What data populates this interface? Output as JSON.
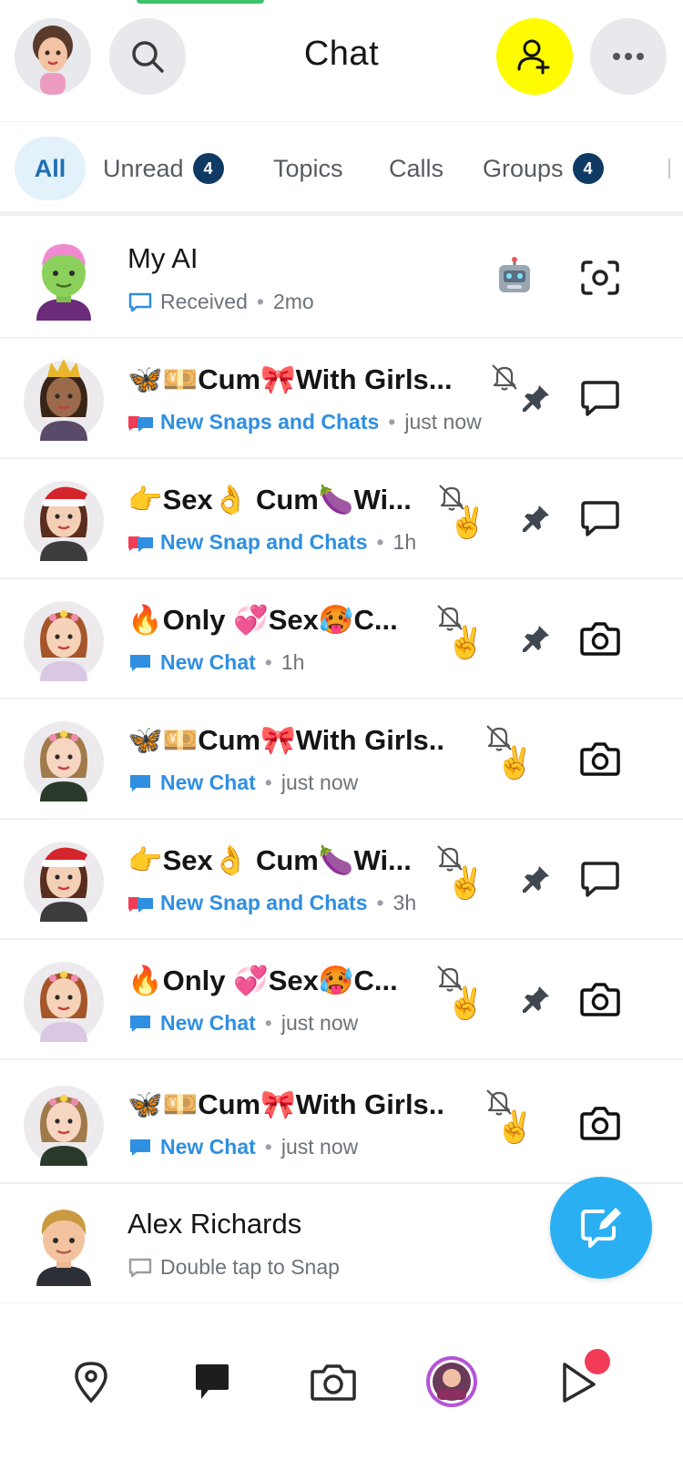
{
  "header": {
    "title": "Chat"
  },
  "tabs": [
    {
      "label": "All"
    },
    {
      "label": "Unread",
      "badge": "4"
    },
    {
      "label": "Topics"
    },
    {
      "label": "Calls"
    },
    {
      "label": "Groups",
      "badge": "4"
    }
  ],
  "chats": [
    {
      "name": "My AI",
      "status": "Received",
      "time": "2mo",
      "right_icon": "chat-icon",
      "extra_icon": "robot-icon"
    },
    {
      "name": "🦋💴Cum🎀With Girls...",
      "status": "New Snaps and Chats",
      "time": "just now",
      "muted": true,
      "pinned": true,
      "right_icon": "chat-icon"
    },
    {
      "name": "👉Sex👌 Cum🍆Wi...",
      "status": "New Snap and Chats",
      "time": "1h",
      "muted": true,
      "hand": "✌️",
      "pinned": true,
      "right_icon": "chat-icon"
    },
    {
      "name": "🔥Only 💞Sex🥵C...",
      "status": "New Chat",
      "time": "1h",
      "muted": true,
      "hand": "✌️",
      "pinned": true,
      "right_icon": "camera-icon"
    },
    {
      "name": "🦋💴Cum🎀With Girls..",
      "status": "New Chat",
      "time": "just now",
      "muted": true,
      "hand": "✌️",
      "right_icon": "camera-icon"
    },
    {
      "name": "👉Sex👌 Cum🍆Wi...",
      "status": "New Snap and Chats",
      "time": "3h",
      "muted": true,
      "hand": "✌️",
      "pinned": true,
      "right_icon": "chat-icon"
    },
    {
      "name": "🔥Only 💞Sex🥵C...",
      "status": "New Chat",
      "time": "just now",
      "muted": true,
      "hand": "✌️",
      "pinned": true,
      "right_icon": "camera-icon"
    },
    {
      "name": "🦋💴Cum🎀With Girls..",
      "status": "New Chat",
      "time": "just now",
      "muted": true,
      "hand": "✌️",
      "right_icon": "camera-icon"
    },
    {
      "name": "Alex Richards",
      "status": "Double tap to Snap"
    }
  ],
  "colors": {
    "accent_blue": "#2f8fe0",
    "snap_red": "#f23c57",
    "snap_yellow": "#fffc00",
    "fab_blue": "#2ab0f2",
    "badge_navy": "#0f3a63"
  },
  "bottom_nav": [
    {
      "icon": "map-pin-icon"
    },
    {
      "icon": "chat-bubble-icon",
      "active": true
    },
    {
      "icon": "camera-icon"
    },
    {
      "icon": "stories-icon"
    },
    {
      "icon": "spotlight-icon",
      "notification": true
    }
  ]
}
